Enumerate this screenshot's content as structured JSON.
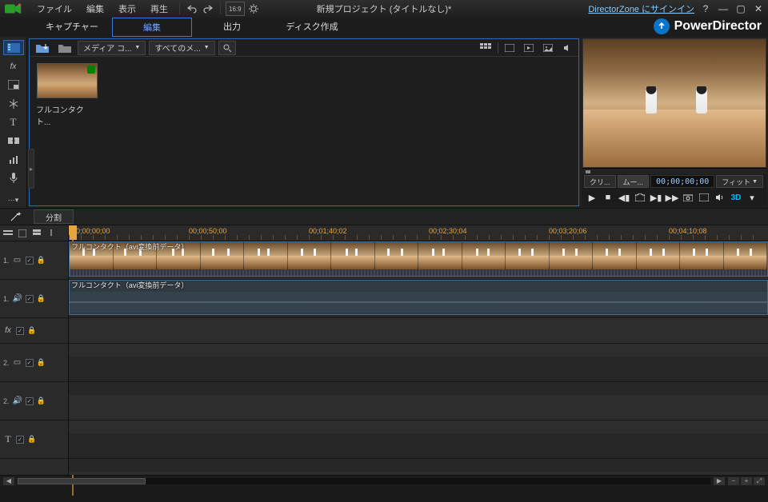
{
  "menubar": {
    "items": [
      "ファイル",
      "編集",
      "表示",
      "再生"
    ],
    "title": "新規プロジェクト (タイトルなし)*",
    "signin": "DirectorZone にサインイン",
    "aspect": "16:9"
  },
  "modes": {
    "capture": "キャプチャー",
    "edit": "編集",
    "output": "出力",
    "disc": "ディスク作成",
    "active": "edit"
  },
  "brand": {
    "name": "PowerDirector"
  },
  "media_toolbar": {
    "room_label": "メディア コ...",
    "filter_label": "すべてのメ..."
  },
  "media_items": [
    {
      "label": "フルコンタクト..."
    }
  ],
  "preview": {
    "btn1": "クリ...",
    "btn2": "ムー...",
    "timecode": "00;00;00;00",
    "fit": "フィット"
  },
  "secondrow": {
    "split": "分割"
  },
  "timeline": {
    "ruler": [
      "00;00;00;00",
      "00;00;50;00",
      "00;01;40;02",
      "00;02;30;04",
      "00;03;20;06",
      "00;04;10;08"
    ],
    "tracks": [
      {
        "id": "1",
        "icon": "▭",
        "label": "1."
      },
      {
        "id": "1a",
        "icon": "🔊",
        "label": "1."
      },
      {
        "id": "fx",
        "icon": "fx",
        "label": "fx"
      },
      {
        "id": "2",
        "icon": "▭",
        "label": "2."
      },
      {
        "id": "2a",
        "icon": "🔊",
        "label": "2."
      },
      {
        "id": "T",
        "icon": "T",
        "label": "T"
      }
    ],
    "clip_video_label": "フルコンタクト（avi変換前データ）",
    "clip_audio_label": "フルコンタクト（avi変換前データ）"
  }
}
